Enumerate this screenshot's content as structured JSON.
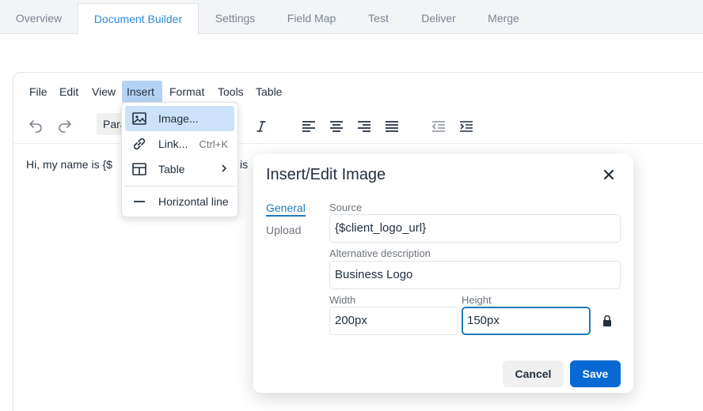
{
  "tabs": [
    {
      "label": "Overview"
    },
    {
      "label": "Document Builder",
      "active": true
    },
    {
      "label": "Settings"
    },
    {
      "label": "Field Map"
    },
    {
      "label": "Test"
    },
    {
      "label": "Deliver"
    },
    {
      "label": "Merge"
    }
  ],
  "menubar": {
    "file": "File",
    "edit": "Edit",
    "view": "View",
    "insert": "Insert",
    "format": "Format",
    "tools": "Tools",
    "table": "Table"
  },
  "toolbar": {
    "block_format": "Para",
    "icons": [
      "undo-icon",
      "redo-icon",
      "italic-icon",
      "align-left-icon",
      "align-center-icon",
      "align-right-icon",
      "align-justify-icon",
      "outdent-icon",
      "indent-icon"
    ]
  },
  "content": {
    "text_left": "Hi, my name is {$",
    "text_right": "is"
  },
  "insert_menu": {
    "image": "Image...",
    "link": "Link...",
    "link_shortcut": "Ctrl+K",
    "table": "Table",
    "horizontal_line": "Horizontal line"
  },
  "dialog": {
    "title": "Insert/Edit Image",
    "tabs": {
      "general": "General",
      "upload": "Upload"
    },
    "source_label": "Source",
    "source_value": "{$client_logo_url}",
    "alt_label": "Alternative description",
    "alt_value": "Business Logo",
    "width_label": "Width",
    "width_value": "200px",
    "height_label": "Height",
    "height_value": "150px",
    "cancel": "Cancel",
    "save": "Save"
  },
  "colors": {
    "accent": "#207ab7",
    "save_button": "#0869d4",
    "menu_open_bg": "#b3d3f5",
    "menu_highlight_bg": "#cce2fa"
  }
}
